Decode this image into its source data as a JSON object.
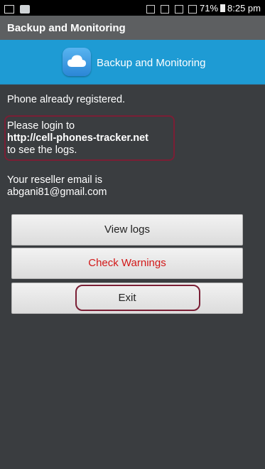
{
  "status_bar": {
    "battery": "71%",
    "time": "8:25 pm"
  },
  "title_bar": {
    "title": "Backup and Monitoring"
  },
  "header": {
    "app_title": "Backup and Monitoring",
    "icon": "cloud-icon"
  },
  "content": {
    "registered": "Phone already registered.",
    "login_line1": "Please login to",
    "login_url": "http://cell-phones-tracker.net",
    "login_line3": "to see the logs.",
    "reseller_line1": "Your reseller email is",
    "reseller_email": "abgani81@gmail.com"
  },
  "buttons": {
    "view_logs": "View logs",
    "check_warnings": "Check Warnings",
    "exit": "Exit"
  },
  "colors": {
    "header": "#1e9bd4",
    "title_bar": "#5d5f61",
    "warning_text": "#d21818",
    "annotation": "#7a1f35"
  }
}
